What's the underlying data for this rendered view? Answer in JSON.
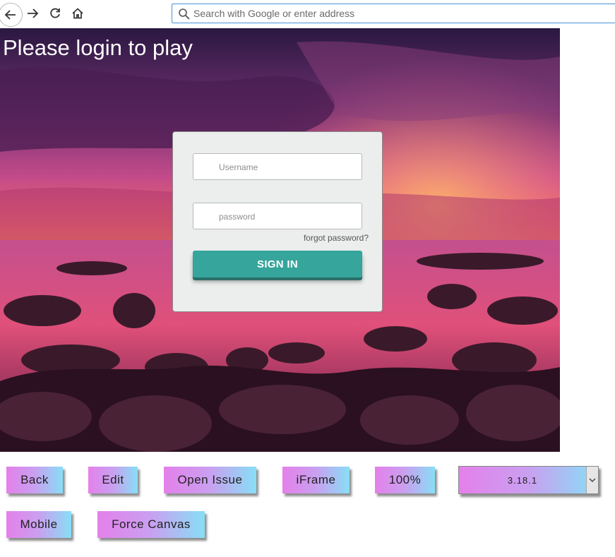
{
  "browser": {
    "search_placeholder": "Search with Google or enter address",
    "icons": [
      "back-arrow-icon",
      "forward-arrow-icon",
      "reload-icon",
      "home-icon",
      "search-icon"
    ]
  },
  "game": {
    "title": "Please login to play",
    "login": {
      "username_placeholder": "Username",
      "password_placeholder": "password",
      "forgot_label": "forgot password?",
      "signin_label": "SIGN IN",
      "signin_color": "#36a59b"
    }
  },
  "controls": {
    "back_label": "Back",
    "edit_label": "Edit",
    "open_issue_label": "Open Issue",
    "iframe_label": "iFrame",
    "zoom_label": "100%",
    "version_value": "3.18.1",
    "mobile_label": "Mobile",
    "force_canvas_label": "Force Canvas",
    "gradient": [
      "#e480ea",
      "#88def6"
    ]
  }
}
